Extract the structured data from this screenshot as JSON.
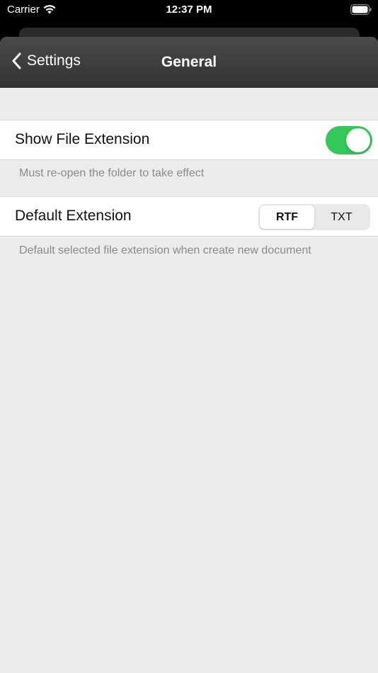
{
  "status_bar": {
    "carrier": "Carrier",
    "time": "12:37 PM"
  },
  "nav": {
    "back_label": "Settings",
    "title": "General"
  },
  "settings": {
    "show_extension": {
      "label": "Show File Extension",
      "enabled": true,
      "note": "Must re-open the folder to take effect"
    },
    "default_extension": {
      "label": "Default Extension",
      "options": [
        "RTF",
        "TXT"
      ],
      "selected": "RTF",
      "note": "Default selected file extension when create new document"
    }
  },
  "colors": {
    "toggle_on": "#34c759",
    "nav_bar": "#3d3d3d",
    "background": "#ececec"
  }
}
